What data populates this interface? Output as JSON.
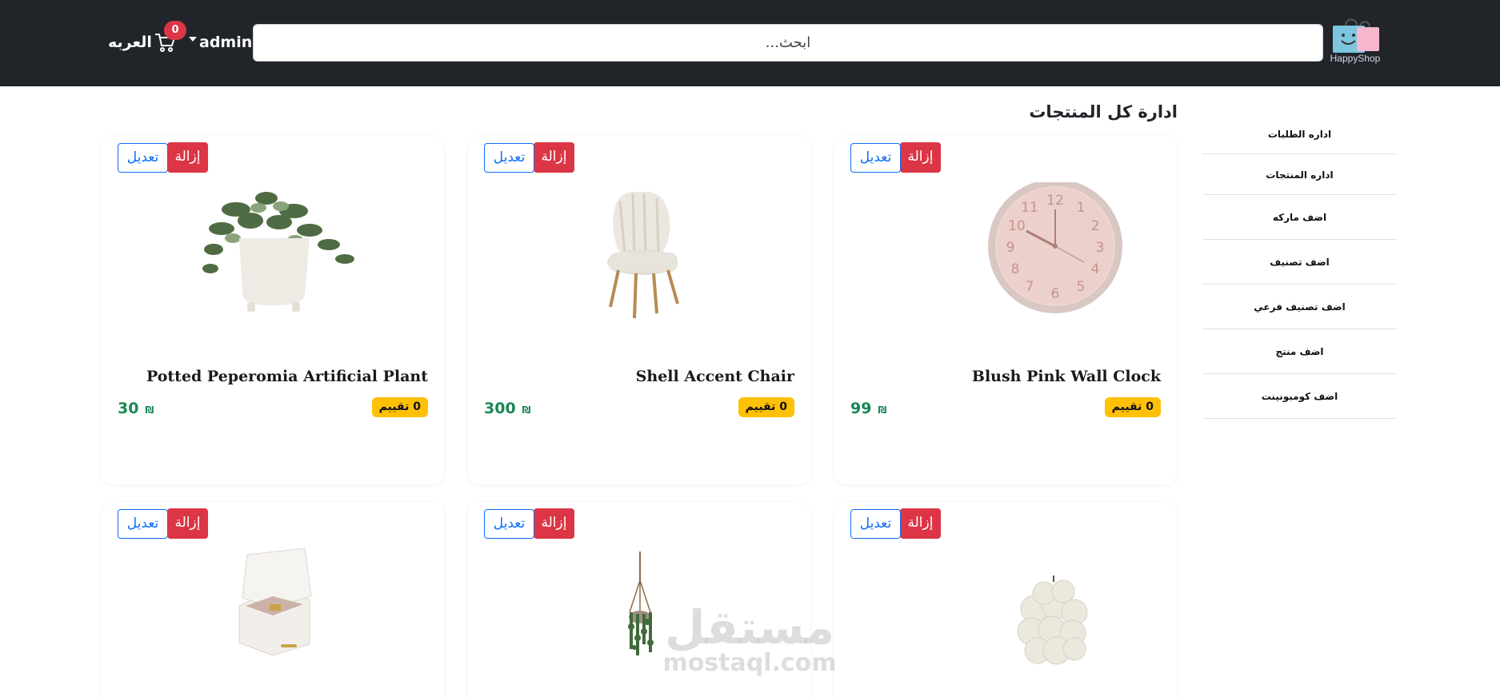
{
  "brand": {
    "logo_text": "HappyShop"
  },
  "header": {
    "search_placeholder": "ابحث...",
    "user_name": "admin",
    "cart_label": "العربه",
    "cart_count": "0"
  },
  "page_title": "ادارة كل المنتجات",
  "sidebar": {
    "items": [
      {
        "label": "اداره الطلبات"
      },
      {
        "label": "اداره المنتجات"
      },
      {
        "label": "اضف ماركه"
      },
      {
        "label": "اضف تصنيف"
      },
      {
        "label": "اضف تصنيف فرعي"
      },
      {
        "label": "اضف منتج"
      },
      {
        "label": "اضف كومبونينت"
      }
    ]
  },
  "actions": {
    "remove_label": "إزالة",
    "edit_label": "تعديل"
  },
  "products": [
    {
      "name": "Blush Pink Wall Clock",
      "rating": "0 تقييم",
      "price": "99",
      "currency": "₪",
      "image": "wall-clock"
    },
    {
      "name": "Shell Accent Chair",
      "rating": "0 تقييم",
      "price": "300",
      "currency": "₪",
      "image": "accent-chair"
    },
    {
      "name": "Potted Peperomia Artificial Plant",
      "rating": "0 تقييم",
      "price": "30",
      "currency": "₪",
      "image": "potted-plant"
    },
    {
      "image": "bubble-candle"
    },
    {
      "image": "hanging-planter"
    },
    {
      "image": "jewelry-box"
    }
  ],
  "watermark": {
    "arabic": "مستقل",
    "latin": "mostaql.com"
  },
  "colors": {
    "navbar": "#212529",
    "danger": "#dc3545",
    "primary": "#0d6efd",
    "rating_badge": "#ffc107",
    "price": "#198754"
  }
}
